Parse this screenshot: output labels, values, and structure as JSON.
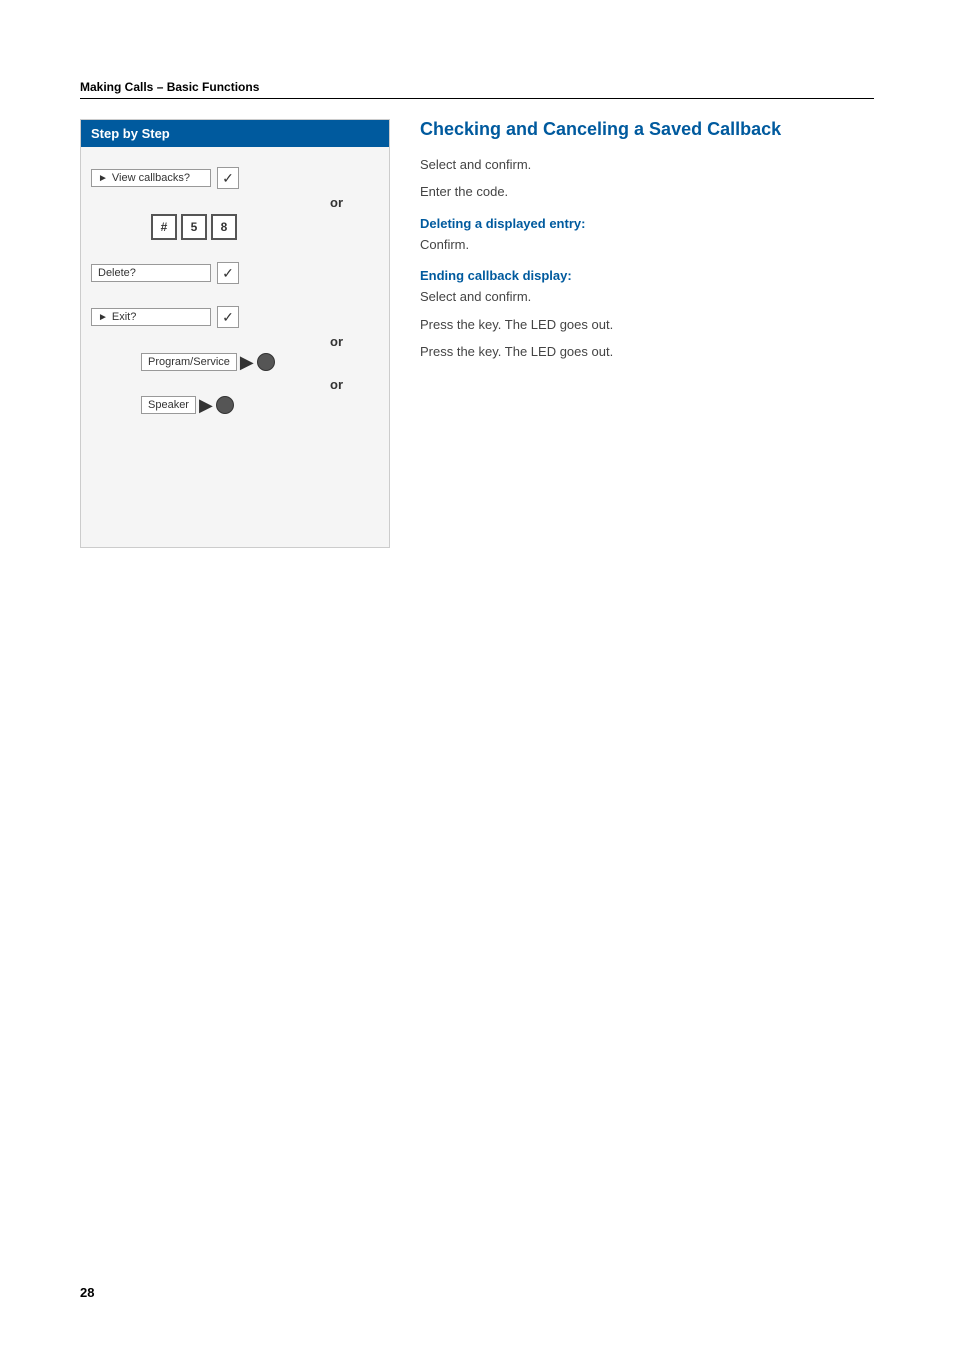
{
  "section_header": "Making Calls – Basic Functions",
  "step_by_step_label": "Step by Step",
  "main_title": "Checking and Canceling a Saved Callback",
  "steps": [
    {
      "type": "menu_check",
      "menu_label": "View callbacks?",
      "has_arrow": true
    },
    {
      "type": "or_label",
      "label": "or"
    },
    {
      "type": "digits",
      "digits": [
        "#",
        "5",
        "8"
      ]
    },
    {
      "type": "sub_title",
      "label": "Deleting a displayed entry:"
    },
    {
      "type": "menu_check",
      "menu_label": "Delete?",
      "has_arrow": false
    },
    {
      "type": "sub_title",
      "label": "Ending callback display:"
    },
    {
      "type": "menu_check",
      "menu_label": "Exit?",
      "has_arrow": true
    },
    {
      "type": "or_label",
      "label": "or"
    },
    {
      "type": "key_led",
      "key_label": "Program/Service"
    },
    {
      "type": "or_label",
      "label": "or"
    },
    {
      "type": "key_led",
      "key_label": "Speaker"
    }
  ],
  "content_blocks": [
    {
      "id": "select_confirm_1",
      "type": "plain",
      "text": "Select and confirm."
    },
    {
      "id": "enter_code",
      "type": "plain",
      "text": "Enter the code."
    },
    {
      "id": "deleting_title",
      "type": "subtitle",
      "text": "Deleting a displayed entry:"
    },
    {
      "id": "confirm",
      "type": "plain",
      "text": "Confirm."
    },
    {
      "id": "ending_title",
      "type": "subtitle",
      "text": "Ending callback display:"
    },
    {
      "id": "select_confirm_2",
      "type": "plain",
      "text": "Select and confirm."
    },
    {
      "id": "press_key_1",
      "type": "plain",
      "text": "Press the key. The LED goes out."
    },
    {
      "id": "press_key_2",
      "type": "plain",
      "text": "Press the key. The LED goes out."
    }
  ],
  "page_number": "28"
}
